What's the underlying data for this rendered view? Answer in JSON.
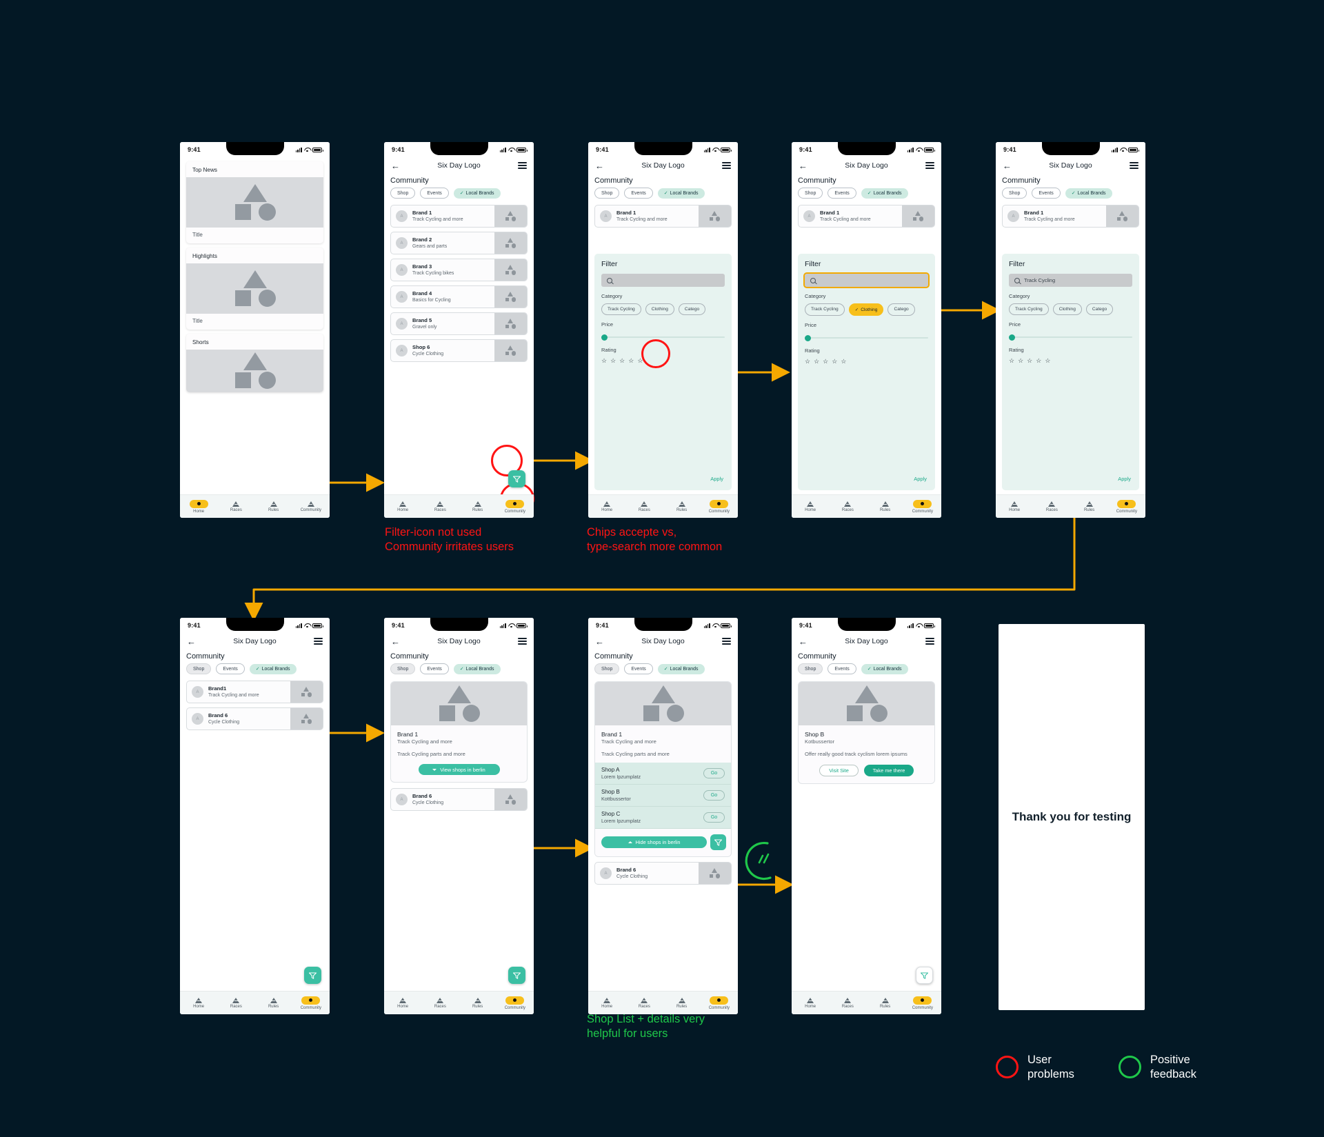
{
  "meta": {
    "background": "#031825",
    "accent_yellow": "#F7BF1B",
    "accent_teal": "#3BBFA3",
    "problem_color": "#FF1414",
    "positive_color": "#1FC84A"
  },
  "status_bar": {
    "time": "9:41"
  },
  "app": {
    "title": "Six Day Logo",
    "back_icon": "back-arrow-icon",
    "menu_icon": "hamburger-icon"
  },
  "bottom_nav": {
    "items": [
      {
        "label": "Home",
        "icon": "triangle-icon"
      },
      {
        "label": "Races",
        "icon": "triangle-icon"
      },
      {
        "label": "Rules",
        "icon": "triangle-icon"
      },
      {
        "label": "Community",
        "icon": "triangle-icon"
      }
    ]
  },
  "home_screen": {
    "cards": [
      {
        "heading": "Top News",
        "footer": "Title"
      },
      {
        "heading": "Highlights",
        "footer": "Title"
      },
      {
        "heading": "Shorts",
        "footer": ""
      }
    ],
    "active_nav": "Home"
  },
  "community": {
    "section_title": "Community",
    "tabs": [
      {
        "label": "Shop",
        "state": "default"
      },
      {
        "label": "Events",
        "state": "default"
      },
      {
        "label": "Local Brands",
        "state": "selected",
        "icon": "check-icon"
      }
    ],
    "active_nav": "Community"
  },
  "brand_list": {
    "items": [
      {
        "name": "Brand 1",
        "subtitle": "Track Cycling and more"
      },
      {
        "name": "Brand 2",
        "subtitle": "Gears and parts"
      },
      {
        "name": "Brand 3",
        "subtitle": "Track Cycling bikes"
      },
      {
        "name": "Brand 4",
        "subtitle": "Basics for Cycling"
      },
      {
        "name": "Brand 5",
        "subtitle": "Gravel only"
      },
      {
        "name": "Shop 6",
        "subtitle": "Cycle Clothing"
      }
    ]
  },
  "filtered_list": {
    "items": [
      {
        "name": "Brand1",
        "subtitle": "Track  Cycling and more"
      },
      {
        "name": "Brand 6",
        "subtitle": "Cycle Clothing"
      }
    ]
  },
  "filter_sheet": {
    "title": "Filter",
    "search_placeholder": "",
    "search_value_filled": "Track Cycling",
    "search_icon": "search-icon",
    "category_label": "Category",
    "category_chips": [
      "Track Cycling",
      "Clothing",
      "Catego"
    ],
    "selected_chip": "Clothing",
    "price_label": "Price",
    "rating_label": "Rating",
    "stars": "☆ ☆ ☆ ☆ ☆",
    "star_count": 5,
    "apply_label": "Apply"
  },
  "fab": {
    "icon": "filter-funnel-icon"
  },
  "brand_detail": {
    "title": "Brand 1",
    "subtitle": "Track Cycling and more",
    "description": "Track Cycling parts and more",
    "view_button": "View shops in berlin",
    "hide_button": "Hide shops in berlin",
    "next_item": {
      "name": "Brand 6",
      "subtitle": "Cycle Clothing"
    }
  },
  "shop_list": {
    "go_label": "Go",
    "shops": [
      {
        "name": "Shop A",
        "address": "Lorem Ipzumplatz"
      },
      {
        "name": "Shop B",
        "address": "Kottbussertor"
      },
      {
        "name": "Shop C",
        "address": "Lorem Ipzumplatz"
      }
    ]
  },
  "shop_detail": {
    "title": "Shop B",
    "subtitle": "Kotbussertor",
    "description": "Offer really good track cyclism lorem ipsums",
    "secondary_button": "Visit Site",
    "primary_button": "Take me there"
  },
  "thank_you": {
    "text": "Thank you\nfor testing"
  },
  "annotations": [
    {
      "id": "problem-1",
      "type": "problem",
      "text": "Filter-icon not used\nCommunity irritates users"
    },
    {
      "id": "problem-2",
      "type": "problem",
      "text": "Chips accepte vs,\ntype-search more common"
    },
    {
      "id": "positive-1",
      "type": "positive",
      "text": "Shop List + details very\nhelpful for users"
    }
  ],
  "legend": {
    "items": [
      {
        "label": "User\nproblems",
        "color": "#FF1414"
      },
      {
        "label": "Positive\nfeedback",
        "color": "#1FC84A"
      }
    ]
  }
}
